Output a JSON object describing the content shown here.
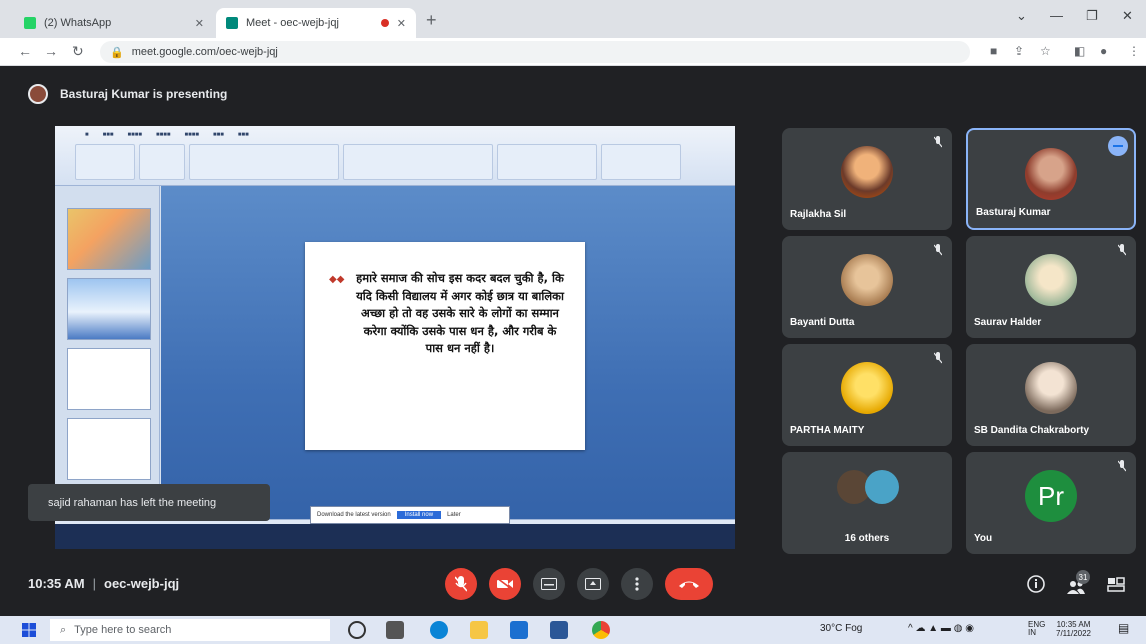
{
  "browser": {
    "tabs": [
      {
        "title": "(2) WhatsApp",
        "active": false,
        "favicon": "whatsapp-icon"
      },
      {
        "title": "Meet - oec-wejb-jqj",
        "active": true,
        "favicon": "meet-icon"
      }
    ],
    "url": "meet.google.com/oec-wejb-jqj"
  },
  "meet": {
    "presenting_banner": "Basturaj Kumar is presenting",
    "toast": "sajid rahaman has left the meeting",
    "slide_text": "हमारे समाज की सोच इस कदर बदल चुकी है, कि यदि किसी विद्यालय में अगर कोई छात्र या बालिका अच्छा हो तो वह उसके सारे के लोगों का सम्मान करेगा क्योंकि उसके पास धन है, और गरीब के पास धन नहीं है।",
    "powerpoint_bubble": {
      "text": "Download the latest version",
      "button": "Install now",
      "link": "Later"
    },
    "participants": [
      {
        "name": "Rajlakha Sil",
        "muted": true
      },
      {
        "name": "Basturaj Kumar",
        "speaking": true
      },
      {
        "name": "Bayanti Dutta",
        "muted": true
      },
      {
        "name": "Saurav Halder",
        "muted": true
      },
      {
        "name": "PARTHA MAITY",
        "muted": true
      },
      {
        "name": "SB Dandita Chakraborty",
        "muted": false
      },
      {
        "name": "16 others",
        "muted": false
      },
      {
        "name": "You",
        "initials": "Pr",
        "muted": true
      }
    ],
    "time": "10:35 AM",
    "meeting_code": "oec-wejb-jqj",
    "participant_count": "31"
  },
  "taskbar": {
    "search_placeholder": "Type here to search",
    "weather": "30°C Fog",
    "lang": "ENG",
    "lang_sub": "IN",
    "clock_time": "10:35 AM",
    "clock_date": "7/11/2022"
  },
  "colors": {
    "meet_bg": "#202124",
    "tile_bg": "#3c4043",
    "red": "#ea4335",
    "accent": "#8ab4f8"
  }
}
